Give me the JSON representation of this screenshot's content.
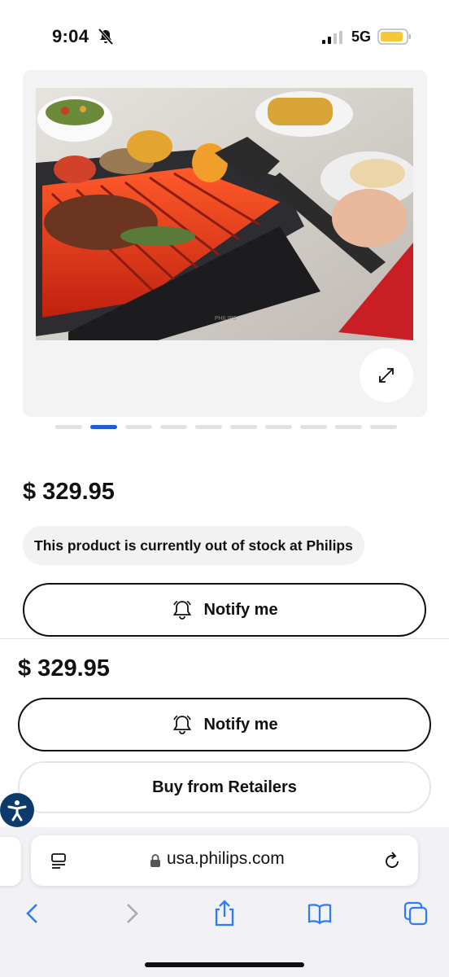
{
  "status_bar": {
    "time": "9:04",
    "network": "5G",
    "icons": [
      "bell-slash-icon",
      "cell-signal-icon",
      "battery-icon"
    ]
  },
  "gallery": {
    "image_alt": "Philips indoor smokeless grill with steak and vegetables",
    "image_brand_text": "PHILIPS",
    "active_slide": 2,
    "slide_count": 10,
    "expand_icon": "expand-arrows-icon"
  },
  "product": {
    "price": "$ 329.95",
    "stock_message": "This product is currently out of stock at Philips",
    "notify_label": "Notify me"
  },
  "sticky_bar": {
    "price": "$ 329.95",
    "notify_label": "Notify me",
    "retailers_label": "Buy from Retailers"
  },
  "browser": {
    "url": "usa.philips.com",
    "toolbar_icons": [
      "back-icon",
      "forward-icon",
      "share-icon",
      "bookmarks-icon",
      "tabs-icon"
    ]
  },
  "colors": {
    "accent": "#1f5fc9",
    "dot_inactive": "#dfe3e6",
    "battery": "#f5c83a",
    "a11y": "#0b3a6b",
    "safari_blue": "#2f7bf5"
  }
}
